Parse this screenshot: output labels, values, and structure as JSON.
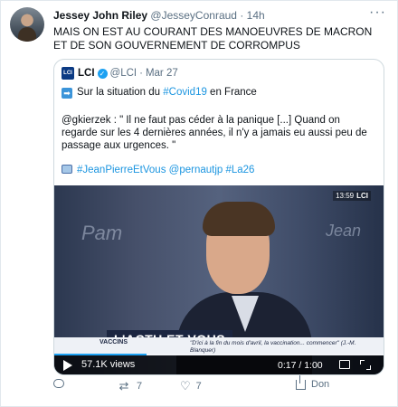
{
  "tweet": {
    "name": "Jessey John Riley",
    "handle": "@JesseyConraud",
    "dot": "·",
    "time": "14h",
    "text": "MAIS ON EST AU COURANT DES MANOEUVRES DE MACRON ET DE SON GOUVERNEMENT DE CORROMPUS",
    "more": "···"
  },
  "quote": {
    "name": "LCI",
    "handle": "@LCI",
    "dot": "·",
    "date": "Mar 27",
    "line1_prefix": "Sur la situation du ",
    "line1_hashtag": "#Covid19",
    "line1_suffix": " en France",
    "body": "@gkierzek : \" Il ne faut pas céder à la panique [...] Quand on regarde sur les 4 dernières années, il n'y a jamais eu aussi peu de passage aux urgences. \"",
    "hashtags": "#JeanPierreEtVous @pernautjp #La26"
  },
  "video": {
    "views": "57.1K views",
    "time": "0:17 / 1:00",
    "progress": 0.28,
    "clock": "13:59",
    "channel": "LCI",
    "lower_third": "L'ACTU ET VOUS",
    "ticker_label": "VACCINS",
    "ticker_text": "\"D'ici à la fin du mois d'avril, la vaccination... commencer\" (J.-M. Blanquer)",
    "studio_left": "Pam",
    "studio_right": "Jean"
  },
  "actions": {
    "retweets": "7",
    "likes": "7",
    "share_label": "Don"
  },
  "colors": {
    "accent": "#1da1f2",
    "text_secondary": "#5b7083",
    "lci_blue": "#0b3a83"
  }
}
